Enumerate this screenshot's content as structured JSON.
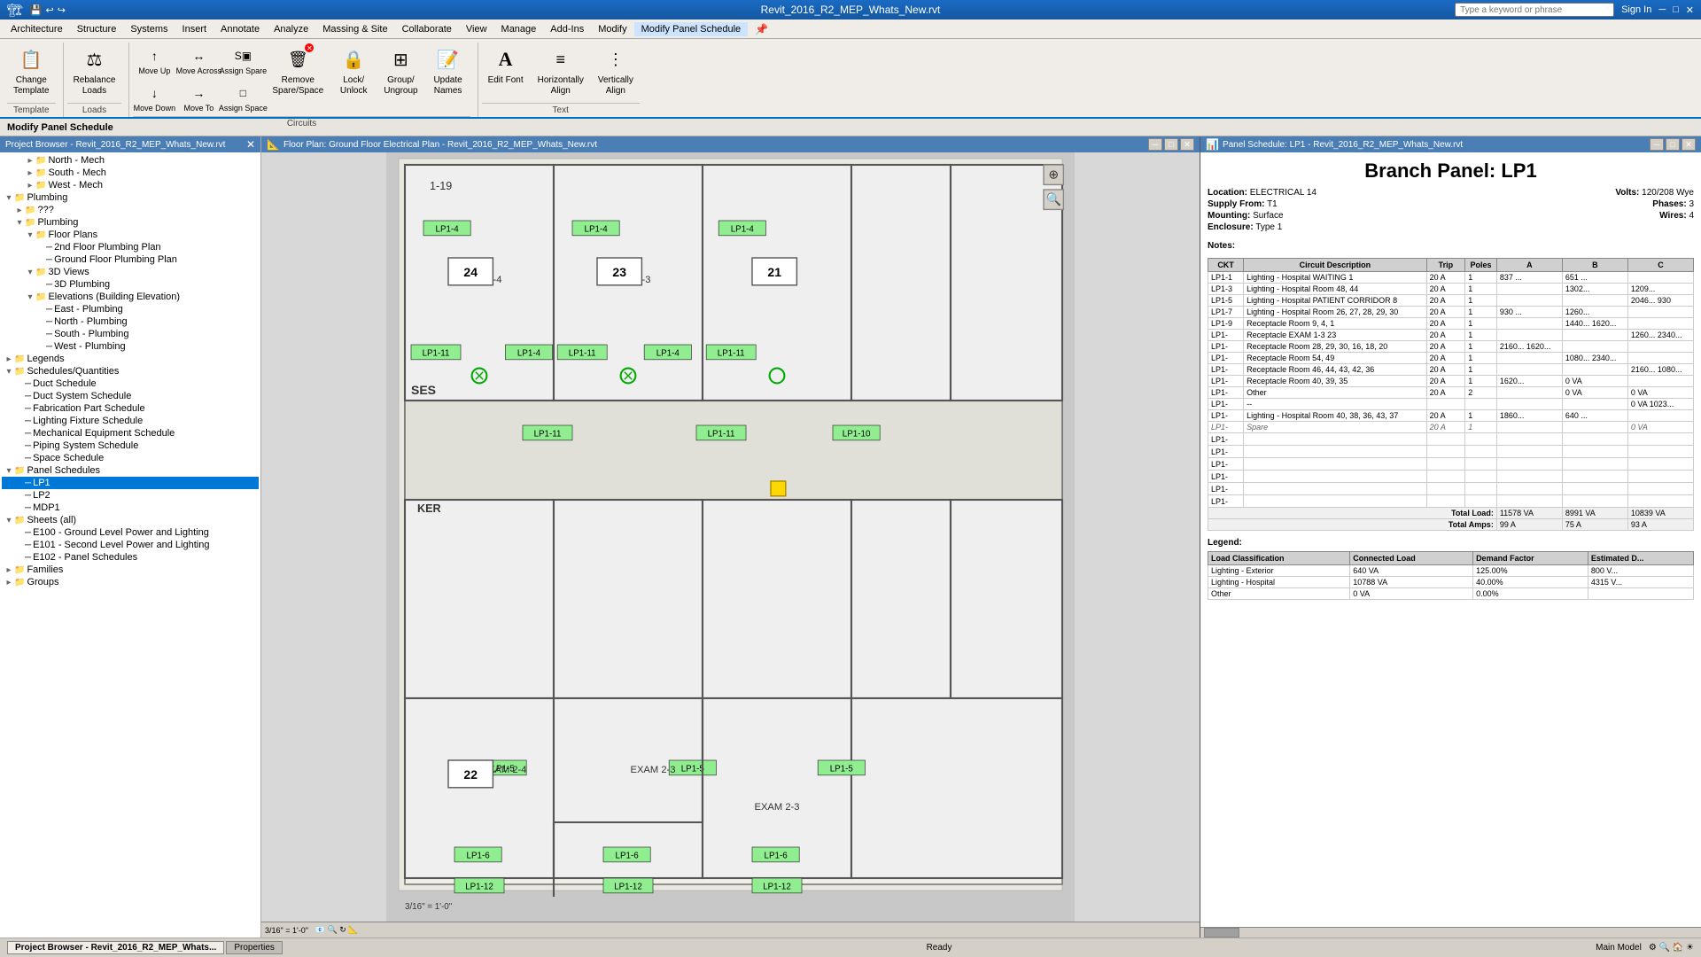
{
  "app": {
    "title": "Revit_2016_R2_MEP_Whats_New.rvt",
    "search_placeholder": "Type a keyword or phrase",
    "sign_in": "Sign In"
  },
  "menu": {
    "items": [
      "Architecture",
      "Structure",
      "Systems",
      "Insert",
      "Annotate",
      "Analyze",
      "Massing & Site",
      "Collaborate",
      "View",
      "Manage",
      "Add-Ins",
      "Modify",
      "Modify Panel Schedule"
    ]
  },
  "ribbon": {
    "groups": [
      {
        "name": "Template",
        "label": "Template",
        "buttons": [
          {
            "id": "change-template",
            "icon": "📋",
            "label": "Change\nTemplate",
            "size": "large"
          }
        ]
      },
      {
        "name": "Loads",
        "label": "Loads",
        "buttons": [
          {
            "id": "rebalance-loads",
            "icon": "⚖",
            "label": "Rebalance\nLoads",
            "size": "large"
          }
        ]
      },
      {
        "name": "Circuits",
        "label": "Circuits",
        "buttons": [
          {
            "id": "move-up",
            "icon": "↑",
            "label": "Move\nUp",
            "size": "small"
          },
          {
            "id": "move-down",
            "icon": "↓",
            "label": "Move\nDown",
            "size": "small"
          },
          {
            "id": "move-across",
            "icon": "↔",
            "label": "Move\nAcross",
            "size": "small"
          },
          {
            "id": "move-to",
            "icon": "→",
            "label": "Move\nTo",
            "size": "small"
          },
          {
            "id": "assign-spare",
            "icon": "S",
            "label": "Assign\nSpare",
            "size": "small"
          },
          {
            "id": "assign-space",
            "icon": "□",
            "label": "Assign\nSpace",
            "size": "small"
          },
          {
            "id": "remove-spare-space",
            "icon": "✕",
            "label": "Remove\nSpare/Space",
            "size": "large",
            "badge": true
          },
          {
            "id": "lock-unlock",
            "icon": "🔒",
            "label": "Lock/\nUnlock",
            "size": "large"
          },
          {
            "id": "group-ungroup",
            "icon": "⊞",
            "label": "Group/\nUngroup",
            "size": "large"
          },
          {
            "id": "update-names",
            "icon": "📝",
            "label": "Update\nNames",
            "size": "large"
          }
        ]
      },
      {
        "name": "Text",
        "label": "Text",
        "buttons": [
          {
            "id": "edit-font",
            "icon": "A",
            "label": "Edit\nFont",
            "size": "large"
          },
          {
            "id": "horizontally-align",
            "icon": "≡",
            "label": "Horizontally\nAlign",
            "size": "large"
          },
          {
            "id": "vertically-align",
            "icon": "⋮",
            "label": "Vertically\nAlign",
            "size": "large"
          }
        ]
      }
    ]
  },
  "modify_bar": {
    "title": "Modify Panel Schedule"
  },
  "project_browser": {
    "title": "Project Browser - Revit_2016_R2_MEP_Whats_New.rvt",
    "tree": [
      {
        "id": "north-mech",
        "label": "North - Mech",
        "level": 3,
        "expanded": false
      },
      {
        "id": "south-mech",
        "label": "South - Mech",
        "level": 3,
        "expanded": false
      },
      {
        "id": "west-mech",
        "label": "West - Mech",
        "level": 3,
        "expanded": false
      },
      {
        "id": "plumbing",
        "label": "Plumbing",
        "level": 1,
        "expanded": true,
        "icon": "📁"
      },
      {
        "id": "plumbing-qqq",
        "label": "???",
        "level": 2,
        "expanded": false
      },
      {
        "id": "plumbing2",
        "label": "Plumbing",
        "level": 2,
        "expanded": true
      },
      {
        "id": "floor-plans",
        "label": "Floor Plans",
        "level": 3,
        "expanded": true
      },
      {
        "id": "2nd-floor-plumbing",
        "label": "2nd Floor Plumbing Plan",
        "level": 4
      },
      {
        "id": "ground-floor-plumbing",
        "label": "Ground Floor Plumbing Plan",
        "level": 4
      },
      {
        "id": "3d-views",
        "label": "3D Views",
        "level": 3,
        "expanded": true
      },
      {
        "id": "3d-plumbing",
        "label": "3D Plumbing",
        "level": 4
      },
      {
        "id": "elevations",
        "label": "Elevations (Building Elevation)",
        "level": 3,
        "expanded": true
      },
      {
        "id": "east-plumbing",
        "label": "East - Plumbing",
        "level": 4
      },
      {
        "id": "north-plumbing",
        "label": "North - Plumbing",
        "level": 4
      },
      {
        "id": "south-plumbing",
        "label": "South - Plumbing",
        "level": 4
      },
      {
        "id": "west-plumbing",
        "label": "West - Plumbing",
        "level": 4
      },
      {
        "id": "legends",
        "label": "Legends",
        "level": 1,
        "expanded": false,
        "icon": "📁"
      },
      {
        "id": "schedules",
        "label": "Schedules/Quantities",
        "level": 1,
        "expanded": true,
        "icon": "📁"
      },
      {
        "id": "duct-schedule",
        "label": "Duct Schedule",
        "level": 2
      },
      {
        "id": "duct-system-schedule",
        "label": "Duct System Schedule",
        "level": 2
      },
      {
        "id": "fabrication-part",
        "label": "Fabrication Part Schedule",
        "level": 2
      },
      {
        "id": "lighting-fixture",
        "label": "Lighting Fixture Schedule",
        "level": 2
      },
      {
        "id": "mechanical-equipment",
        "label": "Mechanical Equipment Schedule",
        "level": 2
      },
      {
        "id": "piping-system",
        "label": "Piping System Schedule",
        "level": 2
      },
      {
        "id": "space-schedule",
        "label": "Space Schedule",
        "level": 2
      },
      {
        "id": "panel-schedules",
        "label": "Panel Schedules",
        "level": 1,
        "expanded": true,
        "icon": "📁"
      },
      {
        "id": "lp1",
        "label": "LP1",
        "level": 2,
        "selected": true
      },
      {
        "id": "lp2",
        "label": "LP2",
        "level": 2
      },
      {
        "id": "mdp1",
        "label": "MDP1",
        "level": 2
      },
      {
        "id": "sheets-all",
        "label": "Sheets (all)",
        "level": 1,
        "expanded": true,
        "icon": "📁"
      },
      {
        "id": "e100",
        "label": "E100 - Ground Level Power and Lighting",
        "level": 2
      },
      {
        "id": "e101",
        "label": "E101 - Second Level Power and Lighting",
        "level": 2
      },
      {
        "id": "e102",
        "label": "E102 - Panel Schedules",
        "level": 2
      },
      {
        "id": "families",
        "label": "Families",
        "level": 1,
        "expanded": false,
        "icon": "📁"
      },
      {
        "id": "groups",
        "label": "Groups",
        "level": 1,
        "expanded": false,
        "icon": "📁"
      }
    ]
  },
  "floor_plan": {
    "title": "Floor Plan: Ground Floor Electrical Plan - Revit_2016_R2_MEP_Whats_New.rvt",
    "scale": "3/16\" = 1'-0\""
  },
  "panel_schedule": {
    "window_title": "Panel Schedule: LP1 - Revit_2016_R2_MEP_Whats_New.rvt",
    "title": "Branch Panel: LP1",
    "location": "ELECTRICAL 14",
    "supply_from": "T1",
    "mounting": "Surface",
    "enclosure": "Type 1",
    "volts": "120/208 Wye",
    "phases": "3",
    "wires": "4",
    "notes_label": "Notes:",
    "columns": [
      "CKT",
      "Circuit Description",
      "Trip",
      "Poles",
      "A",
      "B",
      "C"
    ],
    "rows": [
      {
        "ckt": "LP1-1",
        "desc": "Lighting - Hospital WAITING 1",
        "trip": "20 A",
        "poles": "1",
        "a": "837 ...",
        "b": "651 ...",
        "c": ""
      },
      {
        "ckt": "LP1-3",
        "desc": "Lighting - Hospital Room 48, 44",
        "trip": "20 A",
        "poles": "1",
        "a": "",
        "b": "1302...",
        "c": "1209..."
      },
      {
        "ckt": "LP1-5",
        "desc": "Lighting - Hospital PATIENT CORRIDOR 8",
        "trip": "20 A",
        "poles": "1",
        "a": "",
        "b": "",
        "c": "2046... 930"
      },
      {
        "ckt": "LP1-7",
        "desc": "Lighting - Hospital Room 26, 27, 28, 29, 30",
        "trip": "20 A",
        "poles": "1",
        "a": "930 ...",
        "b": "1260...",
        "c": ""
      },
      {
        "ckt": "LP1-9",
        "desc": "Receptacle Room 9, 4, 1",
        "trip": "20 A",
        "poles": "1",
        "a": "",
        "b": "1440... 1620...",
        "c": ""
      },
      {
        "ckt": "LP1-",
        "desc": "Receptacle EXAM 1-3 23",
        "trip": "20 A",
        "poles": "1",
        "a": "",
        "b": "",
        "c": "1260... 2340..."
      },
      {
        "ckt": "LP1-",
        "desc": "Receptacle Room 28, 29, 30, 16, 18, 20",
        "trip": "20 A",
        "poles": "1",
        "a": "2160... 1620...",
        "b": "",
        "c": ""
      },
      {
        "ckt": "LP1-",
        "desc": "Receptacle Room 54, 49",
        "trip": "20 A",
        "poles": "1",
        "a": "",
        "b": "1080... 2340...",
        "c": ""
      },
      {
        "ckt": "LP1-",
        "desc": "Receptacle Room 46, 44, 43, 42, 36",
        "trip": "20 A",
        "poles": "1",
        "a": "",
        "b": "",
        "c": "2160... 1080..."
      },
      {
        "ckt": "LP1-",
        "desc": "Receptacle Room 40, 39, 35",
        "trip": "20 A",
        "poles": "1",
        "a": "1620...",
        "b": "0 VA",
        "c": ""
      },
      {
        "ckt": "LP1-",
        "desc": "Other",
        "trip": "20 A",
        "poles": "2",
        "a": "",
        "b": "0 VA",
        "c": "0 VA"
      },
      {
        "ckt": "LP1-",
        "desc": "--",
        "trip": "",
        "poles": "",
        "a": "",
        "b": "",
        "c": "0 VA 1023..."
      },
      {
        "ckt": "LP1-",
        "desc": "Lighting - Hospital Room 40, 38, 36, 43, 37",
        "trip": "20 A",
        "poles": "1",
        "a": "1860...",
        "b": "640 ...",
        "c": ""
      },
      {
        "ckt": "LP1-",
        "desc": "Spare",
        "trip": "20 A",
        "poles": "1",
        "a": "",
        "b": "",
        "c": "0 VA",
        "spare": true
      },
      {
        "ckt": "LP1-",
        "desc": "",
        "trip": "",
        "poles": "",
        "a": "",
        "b": "",
        "c": "",
        "empty": true
      },
      {
        "ckt": "LP1-",
        "desc": "",
        "trip": "",
        "poles": "",
        "a": "",
        "b": "",
        "c": "",
        "empty": true
      },
      {
        "ckt": "LP1-",
        "desc": "",
        "trip": "",
        "poles": "",
        "a": "",
        "b": "",
        "c": "",
        "empty": true
      },
      {
        "ckt": "LP1-",
        "desc": "",
        "trip": "",
        "poles": "",
        "a": "",
        "b": "",
        "c": "",
        "empty": true
      },
      {
        "ckt": "LP1-",
        "desc": "",
        "trip": "",
        "poles": "",
        "a": "",
        "b": "",
        "c": "",
        "empty": true
      },
      {
        "ckt": "LP1-",
        "desc": "",
        "trip": "",
        "poles": "",
        "a": "",
        "b": "",
        "c": "",
        "empty": true
      }
    ],
    "totals": {
      "total_load_label": "Total Load:",
      "total_amps_label": "Total Amps:",
      "total_load_a": "11578 VA",
      "total_load_b": "8991 VA",
      "total_load_c": "10839 VA",
      "total_amps_a": "99 A",
      "total_amps_b": "75 A",
      "total_amps_c": "93 A"
    },
    "legend_label": "Legend:",
    "legend_columns": [
      "Load Classification",
      "Connected Load",
      "Demand Factor",
      "Estimated D..."
    ],
    "legend_rows": [
      {
        "class": "Lighting - Exterior",
        "connected": "640 VA",
        "demand": "125.00%",
        "estimated": "800 V..."
      },
      {
        "class": "Lighting - Hospital",
        "connected": "10788 VA",
        "demand": "40.00%",
        "estimated": "4315 V..."
      },
      {
        "class": "Other",
        "connected": "0 VA",
        "demand": "0.00%",
        "estimated": ""
      }
    ]
  },
  "status_bar": {
    "ready": "Ready",
    "scale": "3/16\" = 1'-0\"",
    "model": "Main Model",
    "tabs": [
      "Project Browser - Revit_2016_R2_MEP_Whats...",
      "Properties"
    ]
  }
}
